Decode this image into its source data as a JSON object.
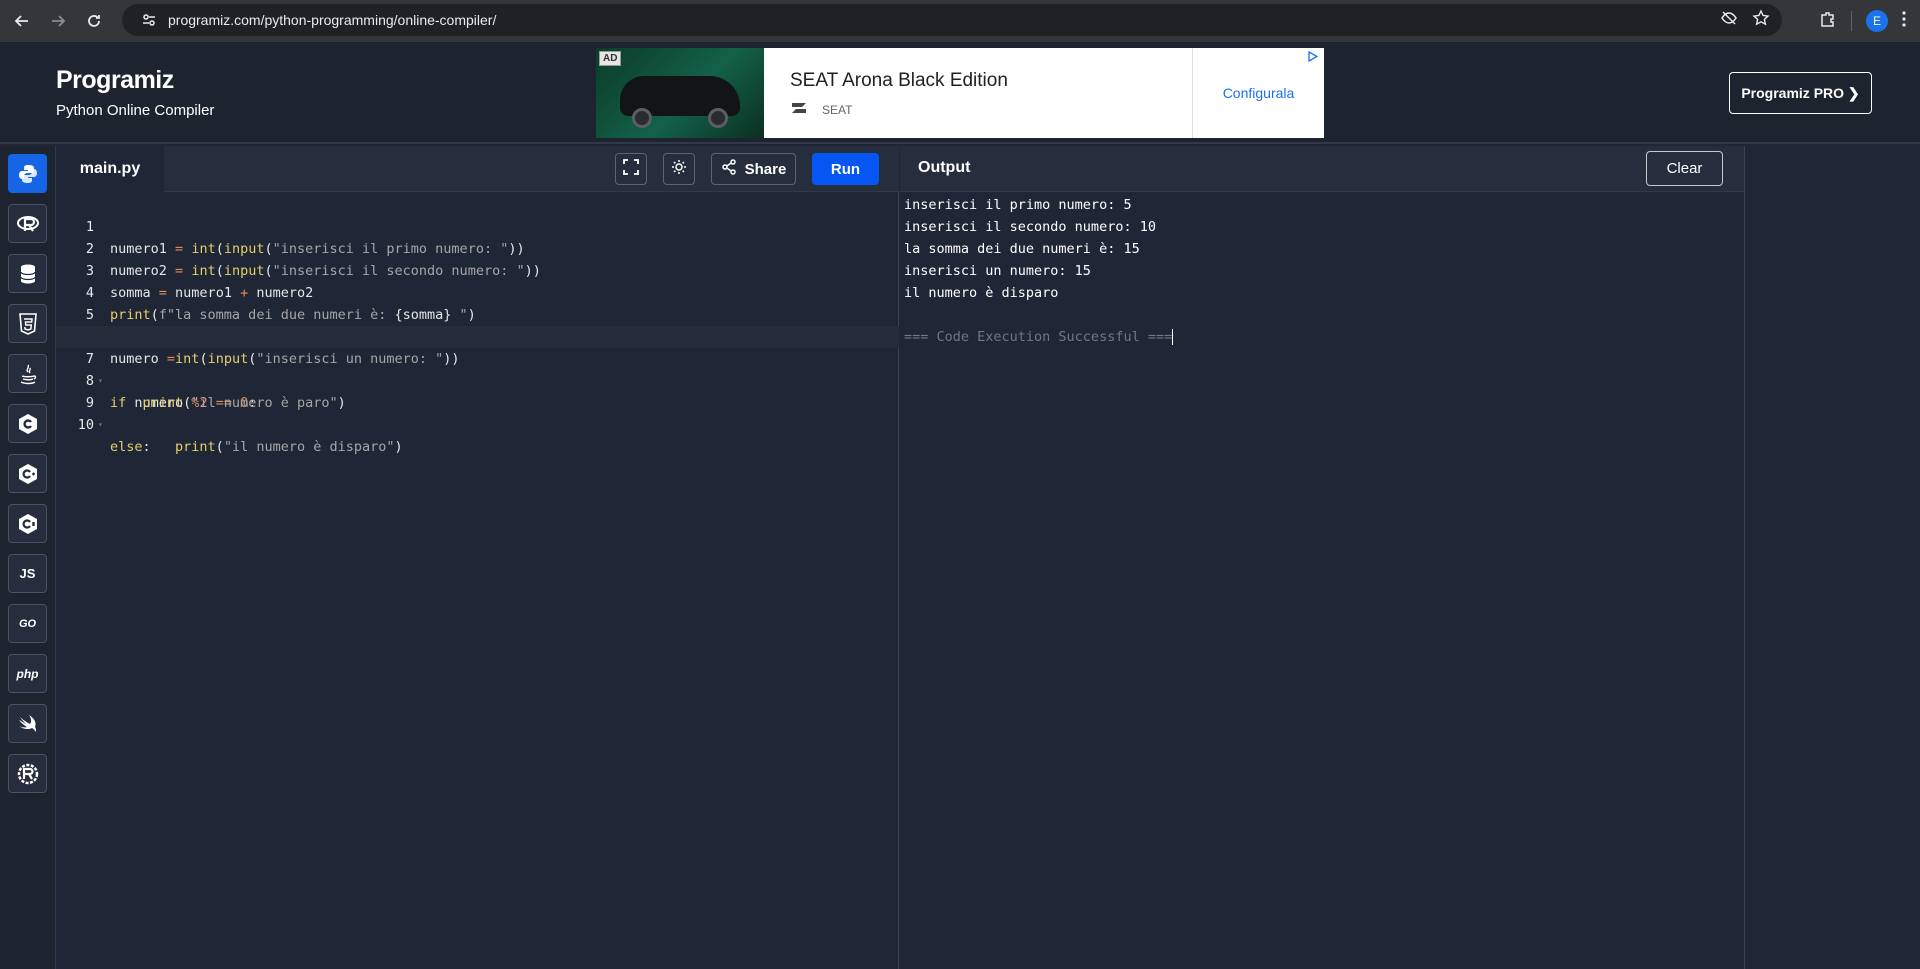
{
  "browser": {
    "url": "programiz.com/python-programming/online-compiler/",
    "profile_initial": "E"
  },
  "header": {
    "logo": "Programiz",
    "subtitle": "Python Online Compiler",
    "pro_button": "Programiz PRO ❯"
  },
  "ad": {
    "badge": "AD",
    "title": "SEAT Arona Black Edition",
    "brand": "SEAT",
    "cta": "Configurala"
  },
  "languages": [
    {
      "name": "python",
      "label": ""
    },
    {
      "name": "r",
      "label": "R"
    },
    {
      "name": "sql",
      "label": ""
    },
    {
      "name": "html",
      "label": "5"
    },
    {
      "name": "java",
      "label": ""
    },
    {
      "name": "c",
      "label": "C"
    },
    {
      "name": "cpp",
      "label": "C"
    },
    {
      "name": "csharp",
      "label": "C"
    },
    {
      "name": "js",
      "label": "JS"
    },
    {
      "name": "go",
      "label": "GO"
    },
    {
      "name": "php",
      "label": "php"
    },
    {
      "name": "swift",
      "label": ""
    },
    {
      "name": "rust",
      "label": "R"
    }
  ],
  "editor": {
    "filename": "main.py",
    "share_label": "Share",
    "run_label": "Run",
    "lines": [
      "numero1 = int(input(\"inserisci il primo numero: \"))",
      "numero2 = int(input(\"inserisci il secondo numero: \"))",
      "somma = numero1 + numero2",
      "print(f\"la somma dei due numeri è: {somma} \")",
      "",
      "numero =int(input(\"inserisci un numero: \"))",
      "if numero %2 == 0:",
      "    print(\"il numero è paro\")",
      "else:",
      "        print(\"il numero è disparo\")"
    ]
  },
  "output": {
    "title": "Output",
    "clear_label": "Clear",
    "lines": [
      "inserisci il primo numero: 5",
      "inserisci il secondo numero: 10",
      "la somma dei due numeri è: 15",
      "inserisci un numero: 15",
      "il numero è disparo",
      "",
      "=== Code Execution Successful ==="
    ]
  }
}
